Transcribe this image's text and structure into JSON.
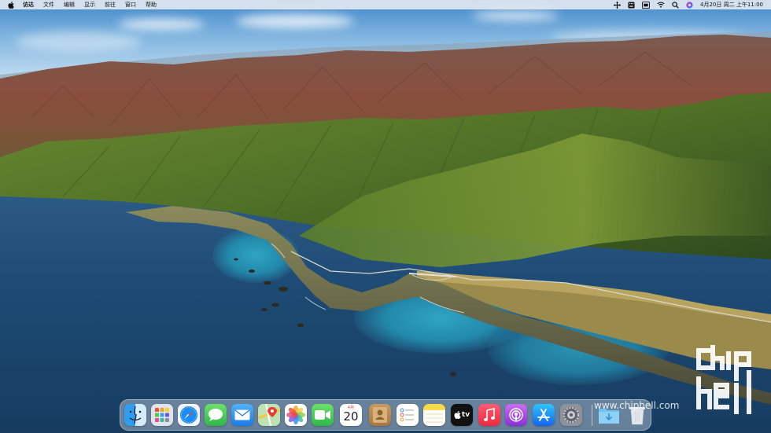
{
  "menubar": {
    "apple": "apple-icon",
    "app_name": "访达",
    "menus": [
      "文件",
      "编辑",
      "显示",
      "前往",
      "窗口",
      "帮助"
    ],
    "status_icons": [
      "move-icon",
      "keyboard-icon",
      "input-method-icon",
      "wifi-icon",
      "search-icon",
      "siri-icon"
    ],
    "clock": "4月20日 周二 上午11:00"
  },
  "dock": {
    "apps": [
      {
        "name": "Finder",
        "icon": "finder-icon"
      },
      {
        "name": "Launchpad",
        "icon": "launchpad-icon"
      },
      {
        "name": "Safari",
        "icon": "safari-icon"
      },
      {
        "name": "Messages",
        "icon": "messages-icon"
      },
      {
        "name": "Mail",
        "icon": "mail-icon"
      },
      {
        "name": "Maps",
        "icon": "maps-icon"
      },
      {
        "name": "Photos",
        "icon": "photos-icon"
      },
      {
        "name": "FaceTime",
        "icon": "facetime-icon"
      },
      {
        "name": "Calendar",
        "icon": "calendar-icon",
        "month": "4月",
        "day": "20"
      },
      {
        "name": "Contacts",
        "icon": "contacts-icon"
      },
      {
        "name": "Reminders",
        "icon": "reminders-icon"
      },
      {
        "name": "Notes",
        "icon": "notes-icon"
      },
      {
        "name": "TV",
        "icon": "tv-icon",
        "label": "tv"
      },
      {
        "name": "Music",
        "icon": "music-icon"
      },
      {
        "name": "Podcasts",
        "icon": "podcasts-icon"
      },
      {
        "name": "App Store",
        "icon": "app-store-icon"
      },
      {
        "name": "System Preferences",
        "icon": "system-preferences-icon"
      },
      {
        "name": "Downloads",
        "icon": "downloads-folder-icon"
      },
      {
        "name": "Trash",
        "icon": "trash-icon"
      }
    ]
  },
  "watermark": {
    "url": "www.chiphell.com",
    "logo": "chiphell-logo"
  }
}
